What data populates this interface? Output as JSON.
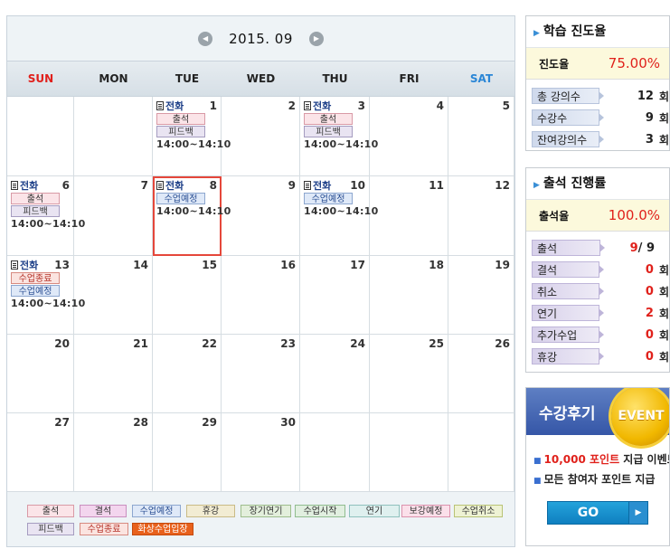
{
  "calendar": {
    "month_title": "2015. 09",
    "prev_icon": "arrow-left-icon",
    "next_icon": "arrow-right-icon",
    "weekdays": [
      "SUN",
      "MON",
      "TUE",
      "WED",
      "THU",
      "FRI",
      "SAT"
    ],
    "weeks": [
      [
        {
          "day": ""
        },
        {
          "day": ""
        },
        {
          "day": "1"
        },
        {
          "day": "2"
        },
        {
          "day": "3"
        },
        {
          "day": "4"
        },
        {
          "day": "5"
        }
      ],
      [
        {
          "day": "6"
        },
        {
          "day": "7"
        },
        {
          "day": "8"
        },
        {
          "day": "9"
        },
        {
          "day": "10"
        },
        {
          "day": "11"
        },
        {
          "day": "12"
        }
      ],
      [
        {
          "day": "13"
        },
        {
          "day": "14"
        },
        {
          "day": "15"
        },
        {
          "day": "16"
        },
        {
          "day": "17"
        },
        {
          "day": "18"
        },
        {
          "day": "19"
        }
      ],
      [
        {
          "day": "20"
        },
        {
          "day": "21"
        },
        {
          "day": "22"
        },
        {
          "day": "23"
        },
        {
          "day": "24"
        },
        {
          "day": "25"
        },
        {
          "day": "26"
        }
      ],
      [
        {
          "day": "27"
        },
        {
          "day": "28"
        },
        {
          "day": "29"
        },
        {
          "day": "30"
        },
        {
          "day": ""
        },
        {
          "day": ""
        },
        {
          "day": ""
        }
      ]
    ],
    "events": [
      {
        "week": 0,
        "col": 2,
        "label": "전화",
        "tags": [
          {
            "text": "출석",
            "kind": "att"
          },
          {
            "text": "피드백",
            "kind": "fb"
          }
        ],
        "time": "14:00~14:10"
      },
      {
        "week": 0,
        "col": 4,
        "label": "전화",
        "tags": [
          {
            "text": "출석",
            "kind": "att"
          },
          {
            "text": "피드백",
            "kind": "fb"
          }
        ],
        "time": "14:00~14:10"
      },
      {
        "week": 1,
        "col": 0,
        "label": "전화",
        "tags": [
          {
            "text": "출석",
            "kind": "att"
          },
          {
            "text": "피드백",
            "kind": "fb"
          }
        ],
        "time": "14:00~14:10"
      },
      {
        "week": 1,
        "col": 2,
        "label": "전화",
        "tags": [
          {
            "text": "수업예정",
            "kind": "sched"
          }
        ],
        "time": "14:00~14:10"
      },
      {
        "week": 1,
        "col": 4,
        "label": "전화",
        "tags": [
          {
            "text": "수업예정",
            "kind": "sched"
          }
        ],
        "time": "14:00~14:10"
      },
      {
        "week": 2,
        "col": 0,
        "label": "전화",
        "tags": [
          {
            "text": "수업종료",
            "kind": "end"
          },
          {
            "text": "수업예정",
            "kind": "sched"
          }
        ],
        "time": "14:00~14:10"
      }
    ],
    "today": {
      "week": 1,
      "col": 2
    },
    "legend": [
      {
        "text": "출석",
        "bg": "#fbe4e8",
        "border": "#d99aa6",
        "color": "#333"
      },
      {
        "text": "결석",
        "bg": "#f3d5ee",
        "border": "#c98fbf",
        "color": "#333"
      },
      {
        "text": "수업예정",
        "bg": "#dfe9f8",
        "border": "#8da7cf",
        "color": "#2a4f93"
      },
      {
        "text": "휴강",
        "bg": "#f2ecd3",
        "border": "#c9bb86",
        "color": "#333"
      },
      {
        "text": "장기연기",
        "bg": "#e3efdc",
        "border": "#9dbd8c",
        "color": "#333"
      },
      {
        "text": "수업시작",
        "bg": "#e1efe0",
        "border": "#90bd8f",
        "color": "#333"
      },
      {
        "text": "연기",
        "bg": "#dff0ef",
        "border": "#8fc1bd",
        "color": "#333"
      },
      {
        "text": "보강예정",
        "bg": "#fbe0ea",
        "border": "#dc92ad",
        "color": "#333"
      },
      {
        "text": "수업취소",
        "bg": "#eef2d4",
        "border": "#b9c374",
        "color": "#333"
      },
      {
        "text": "피드백",
        "bg": "#e9e4f2",
        "border": "#a59cc0",
        "color": "#333"
      },
      {
        "text": "수업종료",
        "bg": "#fbe4e0",
        "border": "#d78a80",
        "color": "#b5342a"
      },
      {
        "text": "화상수업입장",
        "bg": "#e8611c",
        "border": "#c44a0e",
        "color": "#fff"
      }
    ]
  },
  "progress_box": {
    "title": "학습 진도율",
    "rate_label": "진도율",
    "rate_value": "75.00%",
    "rows": [
      {
        "label": "총 강의수",
        "value": "12",
        "unit": "회",
        "red": false
      },
      {
        "label": "수강수",
        "value": "9",
        "unit": "회",
        "red": false
      },
      {
        "label": "잔여강의수",
        "value": "3",
        "unit": "회",
        "red": false
      }
    ]
  },
  "attendance_box": {
    "title": "출석 진행률",
    "rate_label": "출석율",
    "rate_value": "100.0%",
    "rows": [
      {
        "label": "출석",
        "value": "9",
        "value_suffix": "/ 9",
        "unit": "",
        "red": true
      },
      {
        "label": "결석",
        "value": "0",
        "unit": "회",
        "red": true
      },
      {
        "label": "취소",
        "value": "0",
        "unit": "회",
        "red": true
      },
      {
        "label": "연기",
        "value": "2",
        "unit": "회",
        "red": true
      },
      {
        "label": "추가수업",
        "value": "0",
        "unit": "회",
        "red": true
      },
      {
        "label": "휴강",
        "value": "0",
        "unit": "회",
        "red": true
      }
    ]
  },
  "event_box": {
    "title": "수강후기",
    "badge": "EVENT",
    "line1_hl": "10,000 포인트",
    "line1_rest": " 지급 이벤트",
    "line2": "모든 참여자 포인트 지급",
    "go_label": "GO"
  }
}
